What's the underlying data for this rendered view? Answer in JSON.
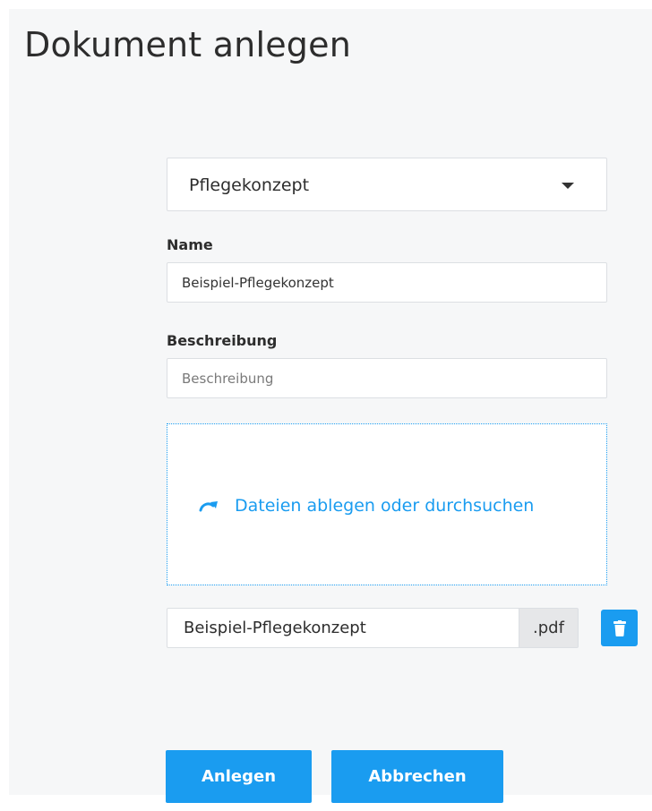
{
  "page": {
    "title": "Dokument anlegen"
  },
  "document_type": {
    "selected": "Pflegekonzept"
  },
  "name_field": {
    "label": "Name",
    "value": "Beispiel-Pflegekonzept"
  },
  "description_field": {
    "label": "Beschreibung",
    "placeholder": "Beschreibung",
    "value": ""
  },
  "dropzone": {
    "text": "Dateien ablegen oder durchsuchen",
    "icon": "redo-arrow-icon"
  },
  "file": {
    "name": "Beispiel-Pflegekonzept",
    "extension": ".pdf",
    "delete_icon": "trash-icon"
  },
  "actions": {
    "create_label": "Anlegen",
    "cancel_label": "Abbrechen"
  },
  "colors": {
    "accent": "#1a9cf0",
    "background": "#f6f7f8",
    "border": "#dcdfe3",
    "text": "#2d2d2d"
  }
}
